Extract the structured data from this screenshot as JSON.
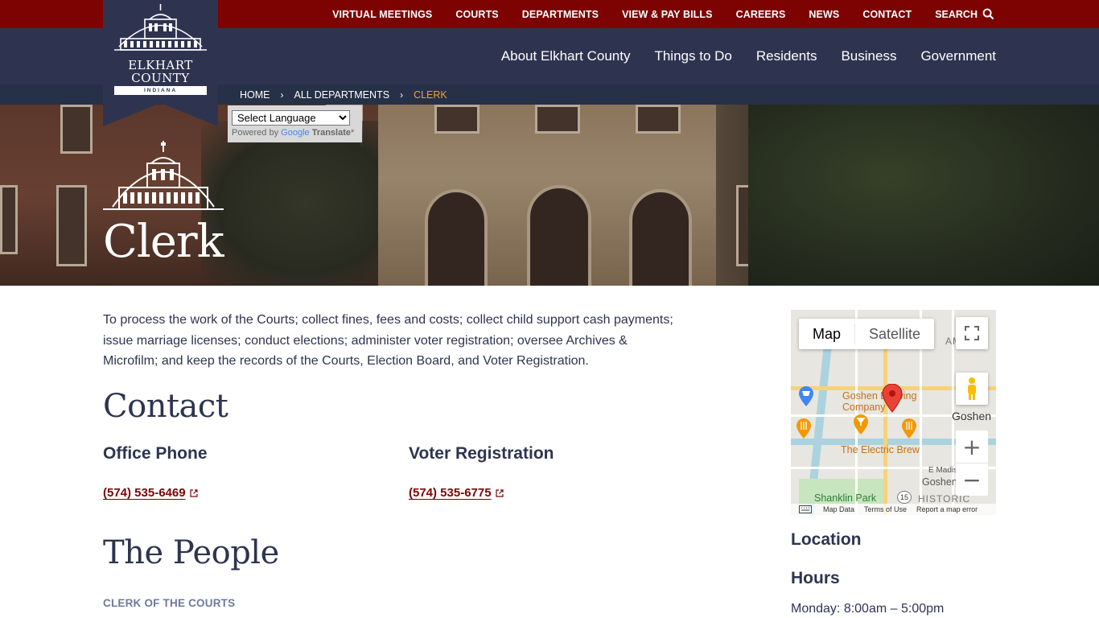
{
  "site": {
    "logo_line1": "ELKHART",
    "logo_line2": "COUNTY",
    "logo_band": "INDIANA"
  },
  "utility_nav": {
    "items": [
      "VIRTUAL MEETINGS",
      "COURTS",
      "DEPARTMENTS",
      "VIEW & PAY BILLS",
      "CAREERS",
      "NEWS",
      "CONTACT"
    ],
    "search_label": "SEARCH"
  },
  "main_nav": {
    "items": [
      "About Elkhart County",
      "Things to Do",
      "Residents",
      "Business",
      "Government"
    ]
  },
  "breadcrumb": {
    "items": [
      "HOME",
      "ALL DEPARTMENTS"
    ],
    "current": "CLERK",
    "separator": "›"
  },
  "translate": {
    "select_value": "Select Language",
    "powered_by": "Powered by",
    "google": "Google",
    "translate_label": "Translate"
  },
  "page": {
    "title": "Clerk",
    "description": "To process the work of the Courts; collect fines, fees and costs; collect child support cash payments; issue marriage licenses; conduct elections; administer voter registration; oversee Archives & Microfilm; and keep the records of the Courts, Election Board, and Voter Registration."
  },
  "contact": {
    "heading": "Contact",
    "office_phone_label": "Office Phone",
    "office_phone": "(574) 535-6469",
    "voter_label": "Voter Registration",
    "voter_phone": "(574) 535-6775"
  },
  "people": {
    "heading": "The People",
    "clerk_label": "CLERK OF THE COURTS"
  },
  "map": {
    "tab_map": "Map",
    "tab_satellite": "Satellite",
    "labels": {
      "brewing": "Goshen Brewing",
      "company": "Company",
      "electric_brew": "The Electric Brew",
      "goshen": "Goshen",
      "goshen_high": "Goshen High",
      "madison": "E Madis",
      "shanklin": "Shanklin Park",
      "historic": "HISTORIC",
      "ame": "AME",
      "route": "15"
    },
    "footer": {
      "data": "Map Data",
      "terms": "Terms of Use",
      "report": "Report a map error"
    }
  },
  "sidebar": {
    "location_heading": "Location",
    "hours_heading": "Hours",
    "hours_line": "Monday: 8:00am – 5:00pm"
  },
  "colors": {
    "top_bar": "#7d0303",
    "nav_bar": "#2e3450",
    "crumb_bar": "#263047",
    "crumb_current": "#e8a23f",
    "link": "#7d0303"
  }
}
